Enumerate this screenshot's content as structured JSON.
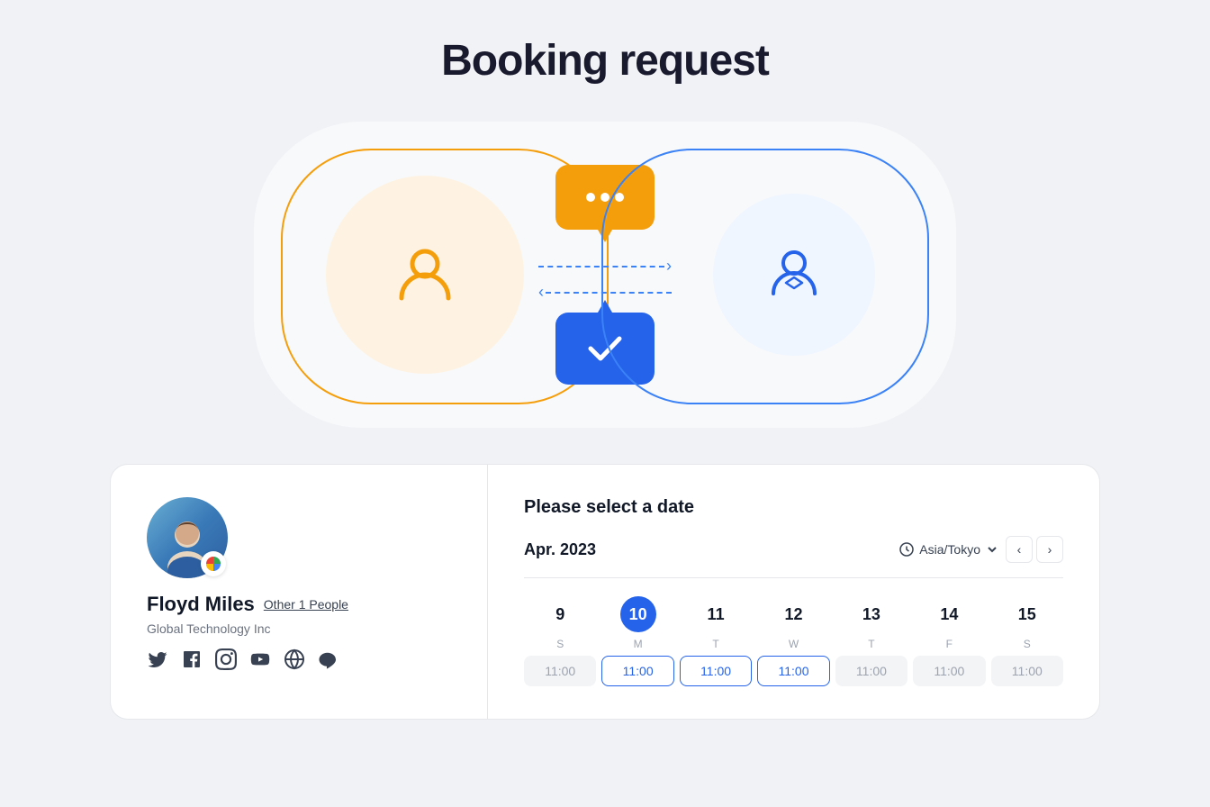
{
  "page": {
    "title": "Booking request"
  },
  "hero": {
    "person_icon_alt": "customer person",
    "host_icon_alt": "host person",
    "chat_bubble_alt": "chat bubble",
    "check_box_alt": "confirmation check"
  },
  "profile": {
    "name": "Floyd Miles",
    "other_people": "Other 1 People",
    "company": "Global Technology Inc",
    "avatar_alt": "Floyd Miles avatar"
  },
  "calendar": {
    "select_date_label": "Please select a date",
    "month_year": "Apr. 2023",
    "timezone": "Asia/Tokyo",
    "nav_prev": "‹",
    "nav_next": "›",
    "days": [
      {
        "number": "9",
        "label": "S",
        "selected": false
      },
      {
        "number": "10",
        "label": "M",
        "selected": true
      },
      {
        "number": "11",
        "label": "T",
        "selected": false
      },
      {
        "number": "12",
        "label": "W",
        "selected": false
      },
      {
        "number": "13",
        "label": "T",
        "selected": false
      },
      {
        "number": "14",
        "label": "F",
        "selected": false
      },
      {
        "number": "15",
        "label": "S",
        "selected": false
      }
    ],
    "time_slots": [
      {
        "time": "11:00",
        "available": false
      },
      {
        "time": "11:00",
        "available": true
      },
      {
        "time": "11:00",
        "available": true
      },
      {
        "time": "11:00",
        "available": true
      },
      {
        "time": "11:00",
        "available": false
      },
      {
        "time": "11:00",
        "available": false
      },
      {
        "time": "11:00",
        "available": false
      }
    ]
  },
  "social": {
    "icons": [
      "twitter",
      "facebook",
      "instagram",
      "youtube",
      "globe",
      "line"
    ]
  }
}
